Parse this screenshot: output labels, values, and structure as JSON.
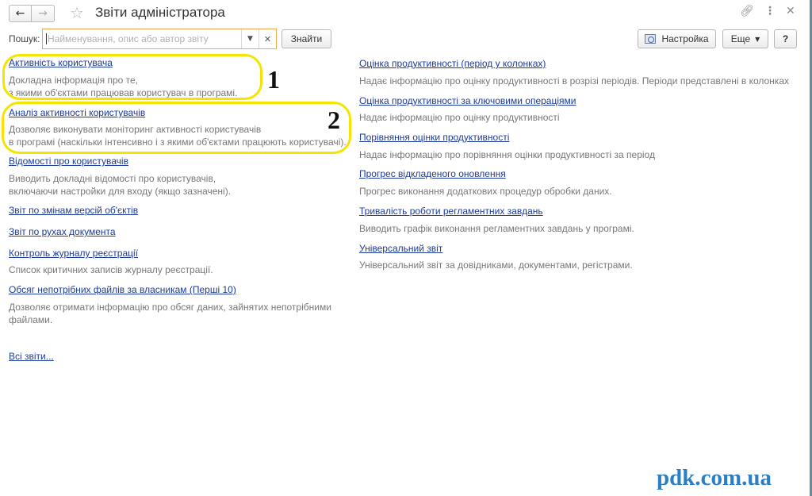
{
  "window": {
    "title": "Звіти адміністратора",
    "back_icon": "arrow-left-icon",
    "forward_icon": "arrow-right-icon",
    "favorite_icon": "star-icon",
    "link_icon": "link-icon",
    "more_icon": "vertical-dots-icon",
    "close_icon": "close-icon"
  },
  "toolbar": {
    "search_label": "Пошук:",
    "search_placeholder": "Найменування, опис або автор звіту",
    "search_value": "",
    "find_button": "Знайти",
    "settings_button": "Настройка",
    "more_button": "Еще",
    "help_button": "?"
  },
  "left_reports": [
    {
      "title": "Активність користувача",
      "desc": [
        "Докладна інформація про те,",
        "з якими об'єктами працював користувач в програмі."
      ]
    },
    {
      "title": "Аналіз активності користувачів",
      "desc": [
        "Дозволяє виконувати моніторинг активності користувачів",
        "в програмі (наскільки інтенсивно і з якими об'єктами працюють користувачі)."
      ]
    },
    {
      "title": "Відомості про користувачів",
      "desc": [
        "Виводить докладні відомості про користувачів,",
        "включаючи настройки для входу (якщо зазначені)."
      ]
    },
    {
      "title": "Звіт по змінам версій об'єктів",
      "desc": []
    },
    {
      "title": "Звіт по рухах документа",
      "desc": []
    },
    {
      "title": "Контроль журналу реєстрації",
      "desc": [
        "Список критичних записів журналу реєстрації."
      ]
    },
    {
      "title": "Обсяг непотрібних файлів за власникам (Перші 10)",
      "desc": [
        "Дозволяє отримати інформацію про обсяг даних, зайнятих непотрібними",
        "файлами."
      ]
    }
  ],
  "all_reports_link": "Всі звіти...",
  "right_reports": [
    {
      "title": "Оцінка продуктивності (період у колонках)",
      "desc": [
        "Надає інформацію про оцінку продуктивності в розрізі періодів. Періоди представлені в колонках"
      ]
    },
    {
      "title": "Оцінка продуктивності за ключовими операціями",
      "desc": [
        "Надає інформацію про оцінку продуктивності"
      ]
    },
    {
      "title": "Порівняння оцінки продуктивності",
      "desc": [
        "Надає інформацію про порівняння оцінки продуктивності за період"
      ]
    },
    {
      "title": "Прогрес відкладеного оновлення",
      "desc": [
        "Прогрес виконання додаткових процедур обробки даних."
      ]
    },
    {
      "title": "Тривалість роботи регламентних завдань",
      "desc": [
        "Виводить графік виконання регламентних завдань у програмі."
      ]
    },
    {
      "title": "Універсальний звіт",
      "desc": [
        "Універсальний звіт за довідниками, документами, регістрами."
      ]
    }
  ],
  "annotations": {
    "marker_1": "1",
    "marker_2": "2",
    "highlight_color": "#f3e500"
  },
  "watermark": "pdk.com.ua",
  "colors": {
    "link": "#1c3b9c",
    "description": "#777777",
    "search_focus": "#f0a64a"
  }
}
